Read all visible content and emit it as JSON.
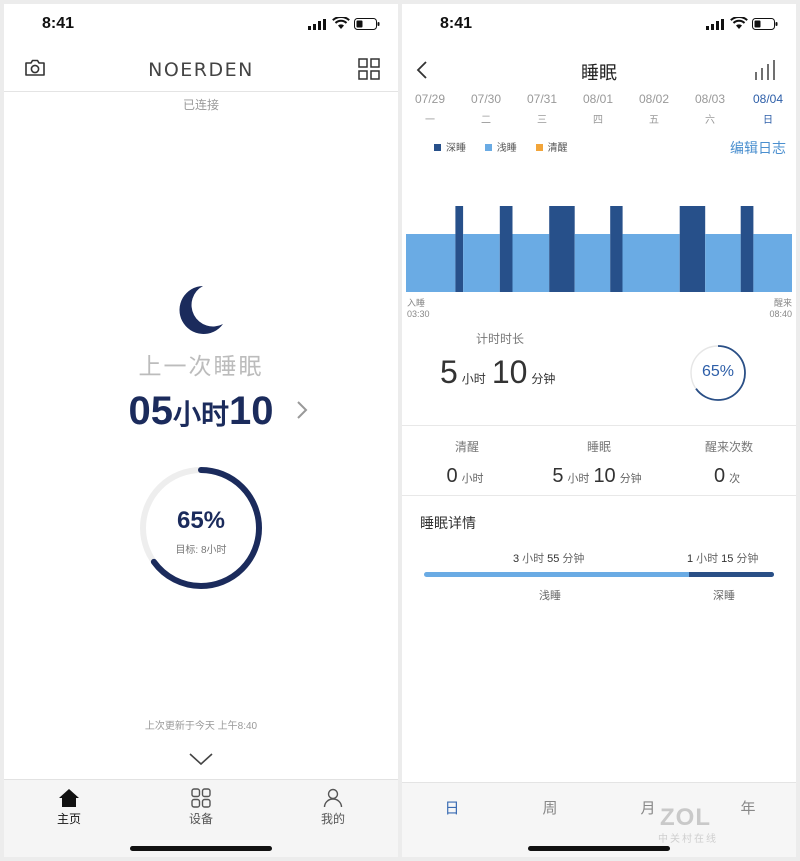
{
  "left": {
    "status_time": "8:41",
    "brand": "NOERDEN",
    "connection_status": "已连接",
    "last_sleep_label": "上一次睡眠",
    "duration": {
      "hours": "05",
      "hours_unit": "小时",
      "minutes": "10"
    },
    "ring": {
      "percent": "65%",
      "value": 0.65,
      "goal": "目标: 8小时"
    },
    "updated": "上次更新于今天 上午8:40",
    "tabs": [
      {
        "label": "主页",
        "icon": "home-icon",
        "active": true
      },
      {
        "label": "设备",
        "icon": "devices-icon",
        "active": false
      },
      {
        "label": "我的",
        "icon": "profile-icon",
        "active": false
      }
    ]
  },
  "right": {
    "status_time": "8:41",
    "title": "睡眠",
    "days": [
      {
        "date": "07/29",
        "weekday": "一"
      },
      {
        "date": "07/30",
        "weekday": "二"
      },
      {
        "date": "07/31",
        "weekday": "三"
      },
      {
        "date": "08/01",
        "weekday": "四"
      },
      {
        "date": "08/02",
        "weekday": "五"
      },
      {
        "date": "08/03",
        "weekday": "六"
      },
      {
        "date": "08/04",
        "weekday": "日",
        "selected": true
      }
    ],
    "legend": [
      {
        "label": "深睡",
        "color": "#27508a"
      },
      {
        "label": "浅睡",
        "color": "#6aabe4"
      },
      {
        "label": "清醒",
        "color": "#f2a53a"
      }
    ],
    "edit_log": "编辑日志",
    "sleep_start": {
      "label": "入睡",
      "time": "03:30"
    },
    "sleep_end": {
      "label": "醒来",
      "time": "08:40"
    },
    "timer": {
      "title": "计时时长",
      "hours": "5",
      "hours_unit": "小时",
      "minutes": "10",
      "minutes_unit": "分钟"
    },
    "ring": {
      "percent": "65%",
      "value": 0.65
    },
    "stats": [
      {
        "label": "清醒",
        "value": "0",
        "unit": "小时"
      },
      {
        "label": "睡眠",
        "value": "5",
        "unit": "小时",
        "value2": "10",
        "unit2": "分钟"
      },
      {
        "label": "醒来次数",
        "value": "0",
        "unit": "次"
      }
    ],
    "detail": {
      "title": "睡眠详情",
      "light": {
        "hours": "3",
        "minutes": "55",
        "label": "浅睡"
      },
      "deep": {
        "hours": "1",
        "minutes": "15",
        "label": "深睡"
      },
      "hour_unit": "小时",
      "minute_unit": "分钟"
    },
    "tabs": [
      {
        "label": "日",
        "active": true
      },
      {
        "label": "周",
        "active": false
      },
      {
        "label": "月",
        "active": false
      },
      {
        "label": "年",
        "active": false
      }
    ],
    "watermark": {
      "logo": "ZOL",
      "sub": "中关村在线"
    }
  },
  "chart_data": {
    "type": "timeline",
    "x_range": [
      "03:30",
      "08:40"
    ],
    "segments": [
      {
        "stage": "浅睡",
        "start": 0.0,
        "end": 0.128
      },
      {
        "stage": "深睡",
        "start": 0.128,
        "end": 0.148
      },
      {
        "stage": "浅睡",
        "start": 0.148,
        "end": 0.243
      },
      {
        "stage": "深睡",
        "start": 0.243,
        "end": 0.276
      },
      {
        "stage": "浅睡",
        "start": 0.276,
        "end": 0.371
      },
      {
        "stage": "深睡",
        "start": 0.371,
        "end": 0.437
      },
      {
        "stage": "浅睡",
        "start": 0.437,
        "end": 0.529
      },
      {
        "stage": "深睡",
        "start": 0.529,
        "end": 0.561
      },
      {
        "stage": "浅睡",
        "start": 0.561,
        "end": 0.709
      },
      {
        "stage": "深睡",
        "start": 0.709,
        "end": 0.775
      },
      {
        "stage": "浅睡",
        "start": 0.775,
        "end": 0.867
      },
      {
        "stage": "深睡",
        "start": 0.867,
        "end": 0.9
      },
      {
        "stage": "浅睡",
        "start": 0.9,
        "end": 1.0
      }
    ]
  }
}
